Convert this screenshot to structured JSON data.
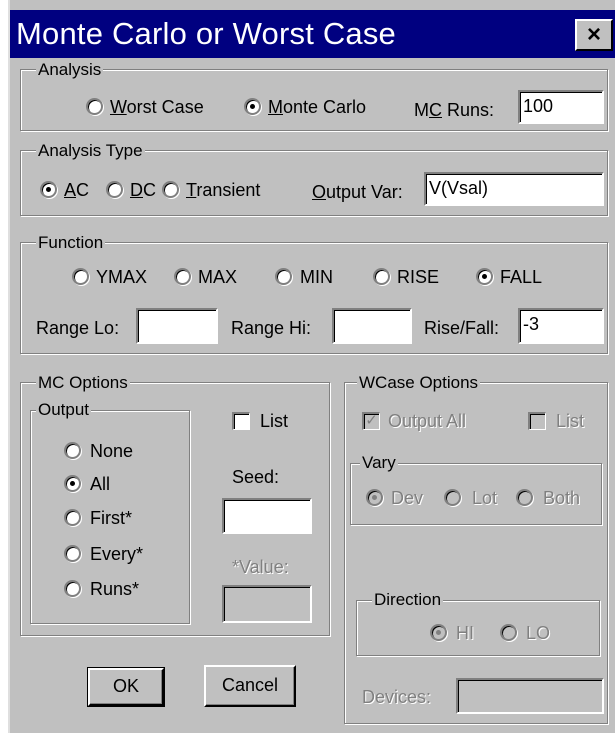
{
  "window": {
    "title": "Monte Carlo or Worst Case",
    "close_glyph": "×"
  },
  "analysis": {
    "group_label": "Analysis",
    "worst_case": {
      "label_u": "W",
      "label_rest": "orst Case",
      "selected": false
    },
    "monte_carlo": {
      "label_u": "M",
      "label_rest": "onte Carlo",
      "selected": true
    },
    "mc_runs": {
      "label_pre": "M",
      "label_u": "C",
      "label_rest": " Runs:",
      "value": "100"
    }
  },
  "analysis_type": {
    "group_label": "Analysis Type",
    "ac": {
      "label_u": "A",
      "label_rest": "C",
      "selected": true
    },
    "dc": {
      "label_u": "D",
      "label_rest": "C",
      "selected": false
    },
    "transient": {
      "label_u": "T",
      "label_rest": "ransient",
      "selected": false
    },
    "output_var": {
      "label_u": "O",
      "label_rest": "utput Var:",
      "value": "V(Vsal)"
    }
  },
  "function": {
    "group_label": "Function",
    "options": [
      {
        "label": "YMAX",
        "selected": false
      },
      {
        "label": "MAX",
        "selected": false
      },
      {
        "label": "MIN",
        "selected": false
      },
      {
        "label": "RISE",
        "selected": false
      },
      {
        "label": "FALL",
        "selected": true
      }
    ],
    "range_lo": {
      "label": "Range Lo:",
      "value": ""
    },
    "range_hi": {
      "label": "Range Hi:",
      "value": ""
    },
    "rise_fall": {
      "label": "Rise/Fall:",
      "value": "-3"
    }
  },
  "mc_options": {
    "group_label": "MC Options",
    "output_label": "Output",
    "output_options": [
      {
        "label": "None",
        "selected": false
      },
      {
        "label": "All",
        "selected": true
      },
      {
        "label": "First*",
        "selected": false
      },
      {
        "label": "Every*",
        "selected": false
      },
      {
        "label": "Runs*",
        "selected": false
      }
    ],
    "list": {
      "label": "List",
      "checked": false
    },
    "seed": {
      "label": "Seed:",
      "value": ""
    },
    "value": {
      "label": "*Value:",
      "value": ""
    }
  },
  "wcase_options": {
    "group_label": "WCase Options",
    "output_all": {
      "label": "Output All",
      "checked": true
    },
    "list": {
      "label": "List",
      "checked": false
    },
    "vary": {
      "group_label": "Vary",
      "options": [
        {
          "label": "Dev",
          "selected": true
        },
        {
          "label": "Lot",
          "selected": false
        },
        {
          "label": "Both",
          "selected": false
        }
      ]
    },
    "direction": {
      "group_label": "Direction",
      "options": [
        {
          "label": "HI",
          "selected": true
        },
        {
          "label": "LO",
          "selected": false
        }
      ]
    },
    "devices": {
      "label": "Devices:",
      "value": ""
    }
  },
  "buttons": {
    "ok": "OK",
    "cancel": "Cancel"
  }
}
